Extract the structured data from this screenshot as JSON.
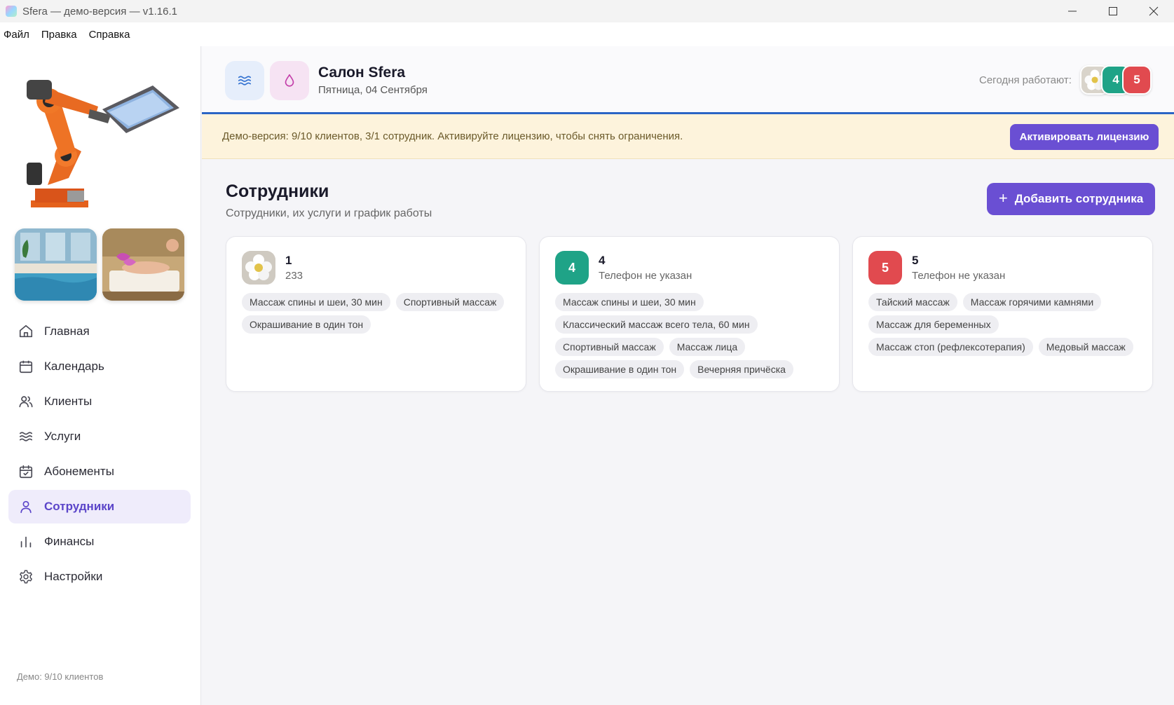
{
  "window": {
    "title": "Sfera — демо-версия — v1.16.1"
  },
  "menu": [
    "Файл",
    "Правка",
    "Справка"
  ],
  "sidebar": {
    "nav": [
      {
        "label": "Главная",
        "icon": "home-icon"
      },
      {
        "label": "Календарь",
        "icon": "calendar-icon"
      },
      {
        "label": "Клиенты",
        "icon": "users-icon"
      },
      {
        "label": "Услуги",
        "icon": "waves-icon"
      },
      {
        "label": "Абонементы",
        "icon": "calendar-check-icon"
      },
      {
        "label": "Сотрудники",
        "icon": "user-icon",
        "active": true
      },
      {
        "label": "Финансы",
        "icon": "bar-chart-icon"
      },
      {
        "label": "Настройки",
        "icon": "gear-icon"
      }
    ],
    "footer": "Демо: 9/10 клиентов"
  },
  "header": {
    "salon_name": "Салон Sfera",
    "date": "Пятница, 04 Сентября",
    "today_label": "Сегодня работают:",
    "today_avatars": [
      {
        "type": "flower-photo"
      },
      {
        "label": "4",
        "color": "#1fa387"
      },
      {
        "label": "5",
        "color": "#e14a4f"
      }
    ]
  },
  "banner": {
    "text": "Демо-версия: 9/10 клиентов, 3/1 сотрудник. Активируйте лицензию, чтобы снять ограничения.",
    "button": "Активировать лицензию"
  },
  "page": {
    "title": "Сотрудники",
    "subtitle": "Сотрудники, их услуги и график работы",
    "add_button": "Добавить сотрудника"
  },
  "employees": [
    {
      "name": "1",
      "phone": "233",
      "avatar": {
        "type": "flower-photo"
      },
      "services": [
        "Массаж спины и шеи, 30 мин",
        "Спортивный массаж",
        "Окрашивание в один тон"
      ]
    },
    {
      "name": "4",
      "phone": "Телефон не указан",
      "avatar": {
        "label": "4",
        "color": "#1fa387"
      },
      "services": [
        "Массаж спины и шеи, 30 мин",
        "Классический массаж всего тела, 60 мин",
        "Спортивный массаж",
        "Массаж лица",
        "Окрашивание в один тон",
        "Вечерняя причёска"
      ]
    },
    {
      "name": "5",
      "phone": "Телефон не указан",
      "avatar": {
        "label": "5",
        "color": "#e14a4f"
      },
      "services": [
        "Тайский массаж",
        "Массаж горячими камнями",
        "Массаж для беременных",
        "Массаж стоп (рефлексотерапия)",
        "Медовый массаж"
      ]
    }
  ],
  "colors": {
    "accent": "#6a4fd3",
    "header_border": "#2a64c5",
    "banner_bg": "#fdf3dc"
  }
}
